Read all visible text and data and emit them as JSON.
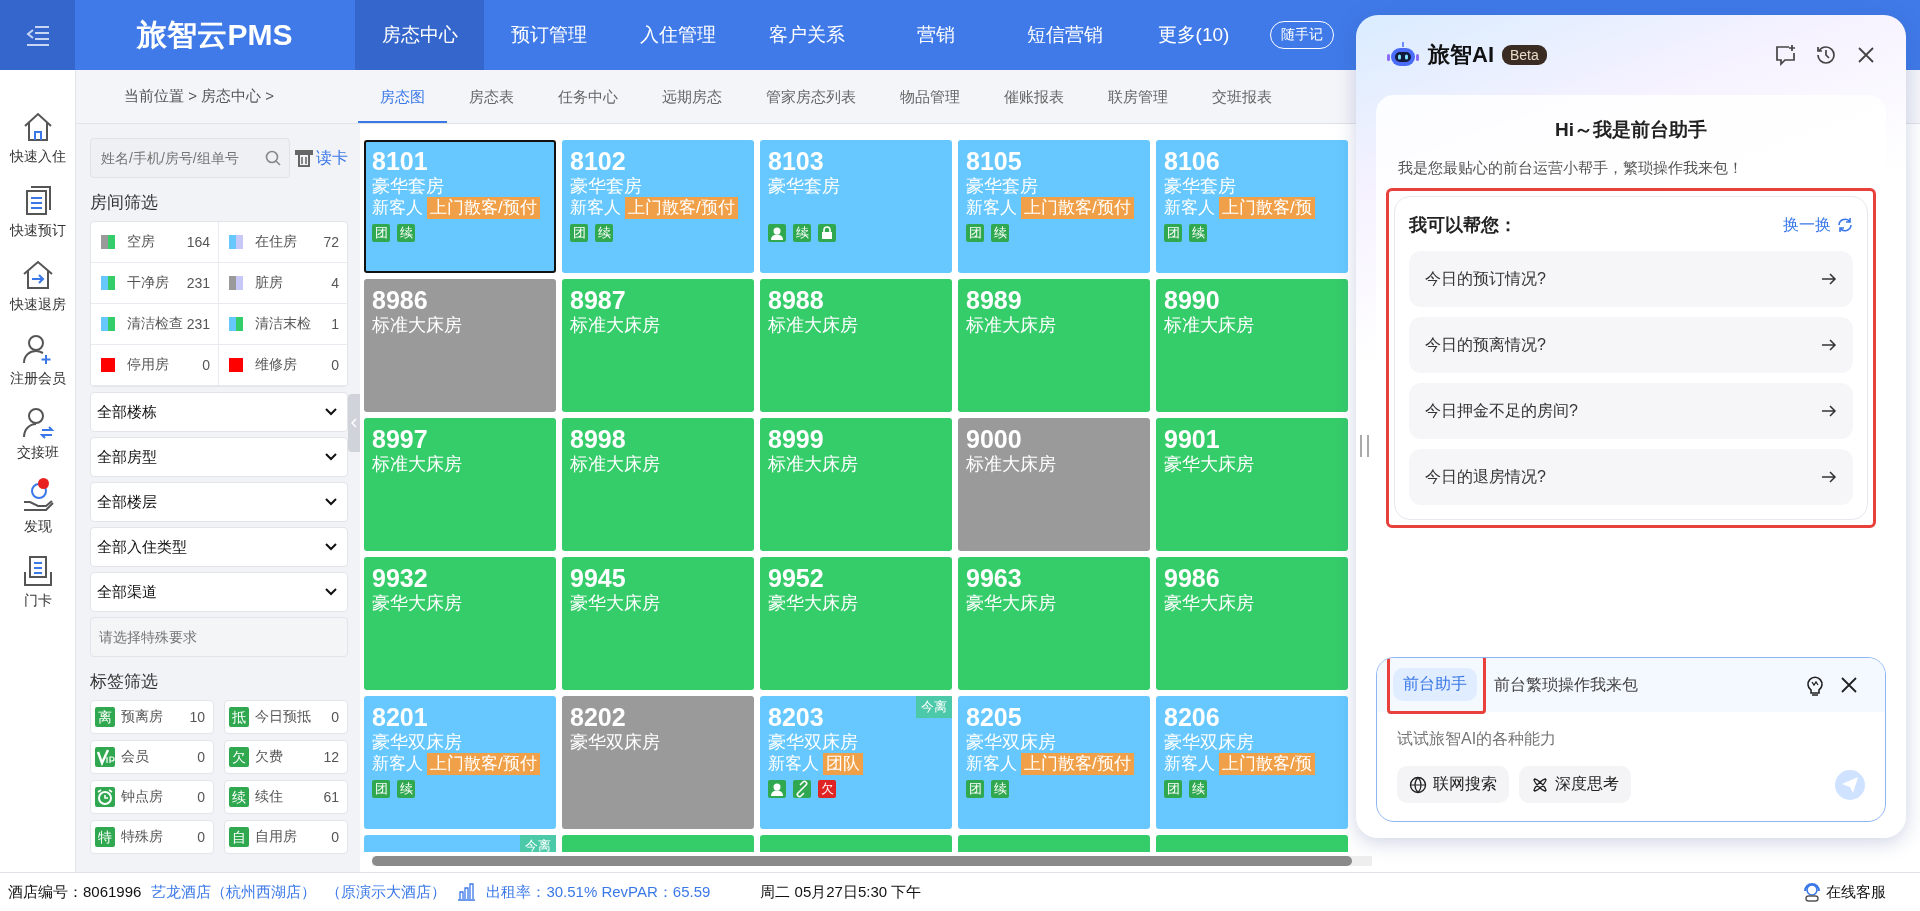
{
  "topbar": {
    "logo": "旅智云PMS",
    "nav": [
      {
        "label": "房态中心",
        "selected": true
      },
      {
        "label": "预订管理",
        "selected": false
      },
      {
        "label": "入住管理",
        "selected": false
      },
      {
        "label": "客户关系",
        "selected": false
      },
      {
        "label": "营销",
        "selected": false
      },
      {
        "label": "短信营销",
        "selected": false
      },
      {
        "label": "更多(10)",
        "selected": false
      }
    ],
    "note_button": "随手记"
  },
  "sidebar": {
    "items": [
      {
        "kind": "checkin",
        "label": "快速入住",
        "notification": false
      },
      {
        "kind": "booking",
        "label": "快速预订",
        "notification": false
      },
      {
        "kind": "checkout",
        "label": "快速退房",
        "notification": false
      },
      {
        "kind": "member",
        "label": "注册会员",
        "notification": false
      },
      {
        "kind": "shift",
        "label": "交接班",
        "notification": false
      },
      {
        "kind": "discover",
        "label": "发现",
        "notification": true
      },
      {
        "kind": "card",
        "label": "门卡",
        "notification": false
      }
    ]
  },
  "breadcrumb": "当前位置 > 房态中心 >",
  "tabs": [
    {
      "label": "房态图",
      "selected": true
    },
    {
      "label": "房态表",
      "selected": false
    },
    {
      "label": "任务中心",
      "selected": false
    },
    {
      "label": "远期房态",
      "selected": false
    },
    {
      "label": "管家房态列表",
      "selected": false
    },
    {
      "label": "物品管理",
      "selected": false
    },
    {
      "label": "催账报表",
      "selected": false
    },
    {
      "label": "联房管理",
      "selected": false
    },
    {
      "label": "交班报表",
      "selected": false
    }
  ],
  "filters": {
    "search_placeholder": "姓名/手机/房号/组单号",
    "read_card": "读卡",
    "room_heading": "房间筛选",
    "room_stats": [
      {
        "label": "空房",
        "count": "164",
        "swatch": [
          {
            "color": "#9a9a9a"
          },
          {
            "color": "#35cc6a"
          }
        ]
      },
      {
        "label": "在住房",
        "count": "72",
        "swatch": [
          {
            "color": "#66c8ff"
          },
          {
            "color": "#c8c8f8"
          }
        ]
      },
      {
        "label": "干净房",
        "count": "231",
        "swatch": [
          {
            "color": "#66c8ff"
          },
          {
            "color": "#35cc6a"
          }
        ]
      },
      {
        "label": "脏房",
        "count": "4",
        "swatch": [
          {
            "color": "#9a9a9a"
          },
          {
            "color": "#c8c8f8"
          }
        ]
      },
      {
        "label": "清洁检查",
        "count": "231",
        "swatch": [
          {
            "color": "#66c8ff"
          },
          {
            "color": "#35cc6a"
          }
        ]
      },
      {
        "label": "清洁末检",
        "count": "1",
        "swatch": [
          {
            "color": "#66c8ff"
          },
          {
            "color": "#35cc6a"
          }
        ]
      },
      {
        "label": "停用房",
        "count": "0",
        "swatch": [
          {
            "color": "#ff0000"
          }
        ]
      },
      {
        "label": "维修房",
        "count": "0",
        "swatch": [
          {
            "color": "#ff0000"
          }
        ]
      }
    ],
    "selects": [
      "全部楼栋",
      "全部房型",
      "全部楼层",
      "全部入住类型",
      "全部渠道"
    ],
    "special_placeholder": "请选择特殊要求",
    "tag_heading": "标签筛选",
    "tag_stats": [
      {
        "kind": "text",
        "icon_text": "离",
        "label": "预离房",
        "count": "10"
      },
      {
        "kind": "text",
        "icon_text": "抵",
        "label": "今日预抵",
        "count": "0"
      },
      {
        "kind": "vip",
        "label": "会员",
        "count": "0"
      },
      {
        "kind": "text",
        "icon_text": "欠",
        "label": "欠费",
        "count": "12"
      },
      {
        "kind": "clock",
        "label": "钟点房",
        "count": "0"
      },
      {
        "kind": "text",
        "icon_text": "续",
        "label": "续住",
        "count": "61"
      },
      {
        "kind": "text",
        "icon_text": "特",
        "label": "特殊房",
        "count": "0"
      },
      {
        "kind": "text",
        "icon_text": "自",
        "label": "自用房",
        "count": "0"
      }
    ]
  },
  "rooms": [
    {
      "number": "8101",
      "type": "豪华套房",
      "kind": "occupied",
      "selected": true,
      "guest": "新客人",
      "guest_tag": "上门散客/预付",
      "tags": [
        {
          "kind": "text",
          "label": "团",
          "color": "#2fa84f"
        },
        {
          "kind": "text",
          "label": "续",
          "color": "#2fa84f"
        }
      ]
    },
    {
      "number": "8102",
      "type": "豪华套房",
      "kind": "occupied",
      "selected": false,
      "guest": "新客人",
      "guest_tag": "上门散客/预付",
      "tags": [
        {
          "kind": "text",
          "label": "团",
          "color": "#2fa84f"
        },
        {
          "kind": "text",
          "label": "续",
          "color": "#2fa84f"
        }
      ]
    },
    {
      "number": "8103",
      "type": "豪华套房",
      "kind": "occupied",
      "selected": false,
      "tags": [
        {
          "kind": "person"
        },
        {
          "kind": "text",
          "label": "续",
          "color": "#2fa84f"
        },
        {
          "kind": "lock"
        }
      ]
    },
    {
      "number": "8105",
      "type": "豪华套房",
      "kind": "occupied",
      "selected": false,
      "guest": "新客人",
      "guest_tag": "上门散客/预付",
      "tags": [
        {
          "kind": "text",
          "label": "团",
          "color": "#2fa84f"
        },
        {
          "kind": "text",
          "label": "续",
          "color": "#2fa84f"
        }
      ]
    },
    {
      "number": "8106",
      "type": "豪华套房",
      "kind": "occupied",
      "selected": false,
      "guest": "新客人",
      "guest_tag": "上门散客/预",
      "tags": [
        {
          "kind": "text",
          "label": "团",
          "color": "#2fa84f"
        },
        {
          "kind": "text",
          "label": "续",
          "color": "#2fa84f"
        }
      ]
    },
    {
      "number": "8986",
      "type": "标准大床房",
      "kind": "dirty",
      "selected": false
    },
    {
      "number": "8987",
      "type": "标准大床房",
      "kind": "vacant",
      "selected": false
    },
    {
      "number": "8988",
      "type": "标准大床房",
      "kind": "vacant",
      "selected": false
    },
    {
      "number": "8989",
      "type": "标准大床房",
      "kind": "vacant",
      "selected": false
    },
    {
      "number": "8990",
      "type": "标准大床房",
      "kind": "vacant",
      "selected": false
    },
    {
      "number": "8997",
      "type": "标准大床房",
      "kind": "vacant",
      "selected": false
    },
    {
      "number": "8998",
      "type": "标准大床房",
      "kind": "vacant",
      "selected": false
    },
    {
      "number": "8999",
      "type": "标准大床房",
      "kind": "vacant",
      "selected": false
    },
    {
      "number": "9000",
      "type": "标准大床房",
      "kind": "dirty",
      "selected": false
    },
    {
      "number": "9901",
      "type": "豪华大床房",
      "kind": "vacant",
      "selected": false
    },
    {
      "number": "9932",
      "type": "豪华大床房",
      "kind": "vacant",
      "selected": false
    },
    {
      "number": "9945",
      "type": "豪华大床房",
      "kind": "vacant",
      "selected": false
    },
    {
      "number": "9952",
      "type": "豪华大床房",
      "kind": "vacant",
      "selected": false
    },
    {
      "number": "9963",
      "type": "豪华大床房",
      "kind": "vacant",
      "selected": false
    },
    {
      "number": "9986",
      "type": "豪华大床房",
      "kind": "vacant",
      "selected": false
    },
    {
      "number": "8201",
      "type": "豪华双床房",
      "kind": "occupied",
      "selected": false,
      "guest": "新客人",
      "guest_tag": "上门散客/预付",
      "tags": [
        {
          "kind": "text",
          "label": "团",
          "color": "#2fa84f"
        },
        {
          "kind": "text",
          "label": "续",
          "color": "#2fa84f"
        }
      ]
    },
    {
      "number": "8202",
      "type": "豪华双床房",
      "kind": "dirty",
      "selected": false
    },
    {
      "number": "8203",
      "type": "豪华双床房",
      "kind": "occupied",
      "selected": false,
      "badge": "今离",
      "guest": "新客人",
      "guest_tag": "团队",
      "tags": [
        {
          "kind": "person"
        },
        {
          "kind": "link"
        },
        {
          "kind": "text",
          "label": "欠",
          "color": "#e02424"
        }
      ]
    },
    {
      "number": "8205",
      "type": "豪华双床房",
      "kind": "occupied",
      "selected": false,
      "guest": "新客人",
      "guest_tag": "上门散客/预付",
      "tags": [
        {
          "kind": "text",
          "label": "团",
          "color": "#2fa84f"
        },
        {
          "kind": "text",
          "label": "续",
          "color": "#2fa84f"
        }
      ]
    },
    {
      "number": "8206",
      "type": "豪华双床房",
      "kind": "occupied",
      "selected": false,
      "guest": "新客人",
      "guest_tag": "上门散客/预",
      "tags": [
        {
          "kind": "text",
          "label": "团",
          "color": "#2fa84f"
        },
        {
          "kind": "text",
          "label": "续",
          "color": "#2fa84f"
        }
      ]
    },
    {
      "kind": "occupied",
      "selected": false,
      "badge": "今离"
    },
    {
      "kind": "vacant",
      "selected": false
    },
    {
      "kind": "vacant",
      "selected": false
    },
    {
      "kind": "vacant",
      "selected": false
    },
    {
      "kind": "vacant",
      "selected": false
    }
  ],
  "status_bar": {
    "hotel_no": "酒店编号：8061996",
    "hotel_name": "艺龙酒店（杭州西湖店）",
    "hotel_alias": "（原演示大酒店）",
    "stats": "出租率：30.51% RevPAR：65.59",
    "datetime": "周二 05月27日5:30 下午",
    "service": "在线客服"
  },
  "ai_panel": {
    "title": "旅智AI",
    "badge": "Beta",
    "greeting": "Hi～我是前台助手",
    "intro": "我是您最贴心的前台运营小帮手，繁琐操作我来包！",
    "help_title": "我可以帮您：",
    "refresh": "换一换",
    "suggestions": [
      "今日的预订情况?",
      "今日的预离情况?",
      "今日押金不足的房间?",
      "今日的退房情况?"
    ],
    "assistant_chip": "前台助手",
    "assistant_desc": "前台繁琐操作我来包",
    "input_placeholder": "试试旅智AI的各种能力",
    "tools": [
      {
        "kind": "web",
        "label": "联网搜索"
      },
      {
        "kind": "think",
        "label": "深度思考"
      }
    ]
  }
}
